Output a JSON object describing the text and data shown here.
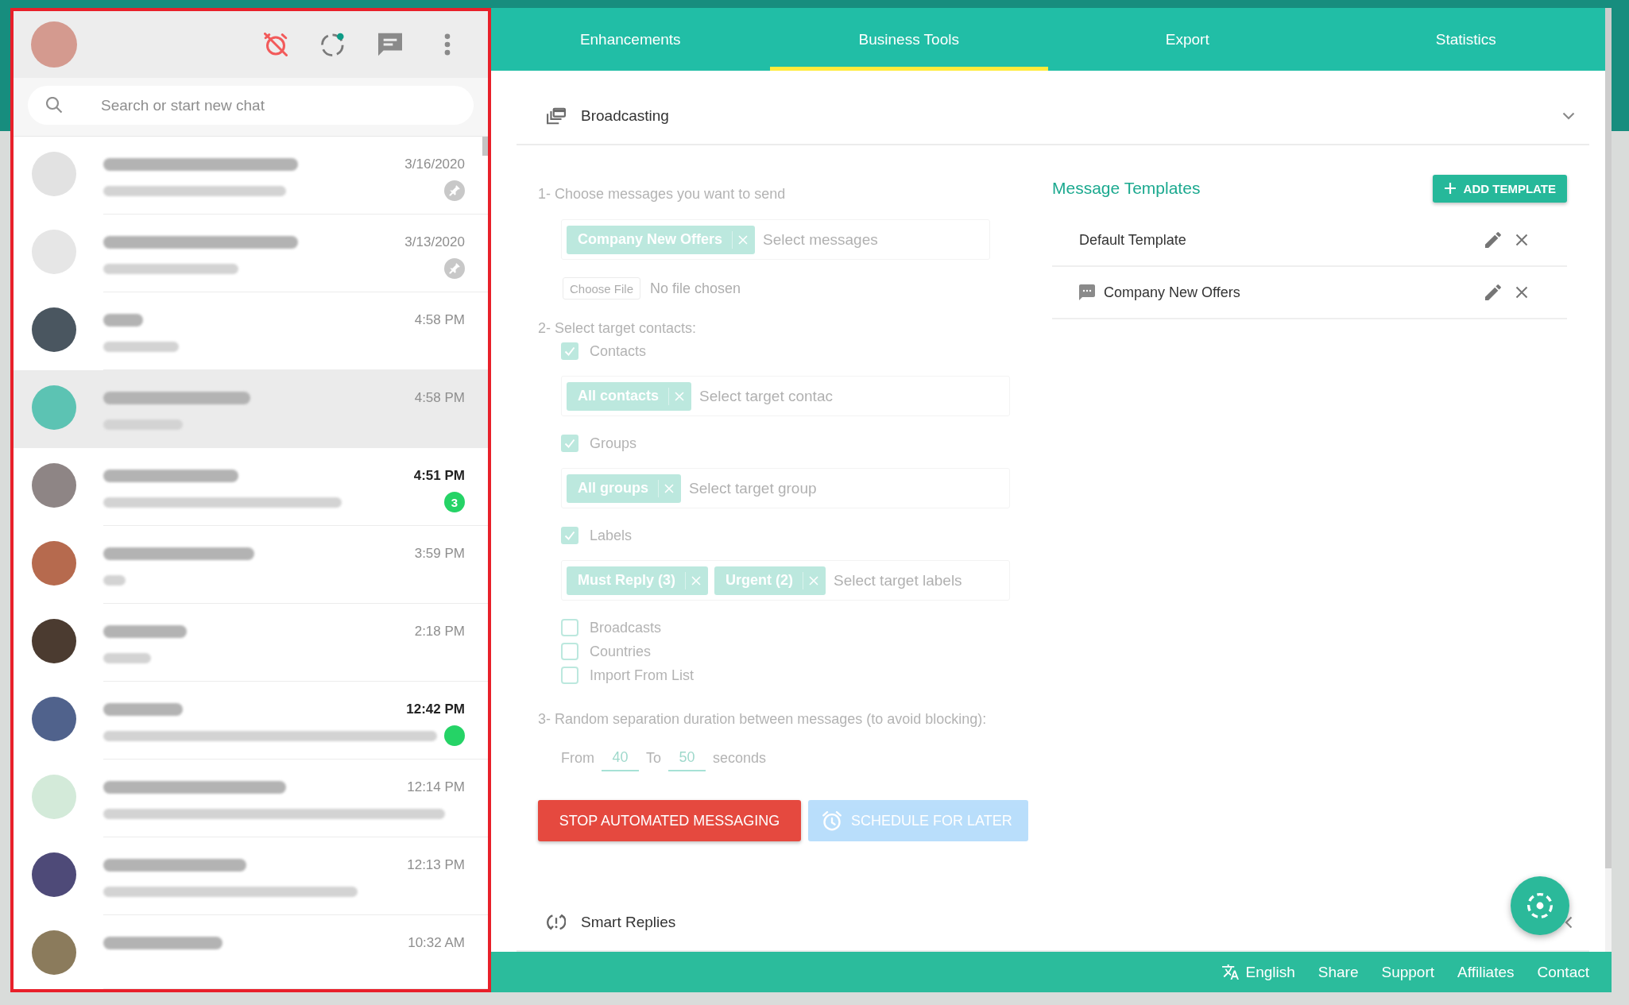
{
  "sidebar": {
    "search": {
      "placeholder": "Search or start new chat"
    },
    "chats": [
      {
        "time": "3/16/2020",
        "selected": false,
        "pinned": true,
        "unread": false
      },
      {
        "time": "3/13/2020",
        "selected": false,
        "pinned": true,
        "unread": false
      },
      {
        "time": "4:58 PM",
        "selected": false,
        "pinned": false,
        "unread": false
      },
      {
        "time": "4:58 PM",
        "selected": true,
        "pinned": false,
        "unread": false
      },
      {
        "time": "4:51 PM",
        "selected": false,
        "pinned": false,
        "unread": true,
        "badge": "3"
      },
      {
        "time": "3:59 PM",
        "selected": false,
        "pinned": false,
        "unread": false
      },
      {
        "time": "2:18 PM",
        "selected": false,
        "pinned": false,
        "unread": false
      },
      {
        "time": "12:42 PM",
        "selected": false,
        "pinned": false,
        "unread": true
      },
      {
        "time": "12:14 PM",
        "selected": false,
        "pinned": false,
        "unread": false
      },
      {
        "time": "12:13 PM",
        "selected": false,
        "pinned": false,
        "unread": false
      },
      {
        "time": "10:32 AM",
        "selected": false,
        "pinned": false,
        "unread": false
      }
    ]
  },
  "tabs": [
    {
      "label": "Enhancements",
      "selected": false
    },
    {
      "label": "Business Tools",
      "selected": true
    },
    {
      "label": "Export",
      "selected": false
    },
    {
      "label": "Statistics",
      "selected": false
    }
  ],
  "sections": [
    {
      "kind": "broadcasting",
      "title": "Broadcasting",
      "expanded": true,
      "broadcast": {
        "disabled": true,
        "step1": {
          "label": "1- Choose messages you want to send",
          "field": {
            "tags": [
              "Company New Offers"
            ],
            "placeholder": "Select messages"
          },
          "file_button": "Choose File",
          "file_status": "No file chosen"
        },
        "step2": {
          "label": "2- Select target contacts:",
          "targets": [
            {
              "label": "Contacts",
              "checked": true,
              "field": {
                "tags": [
                  "All contacts"
                ],
                "placeholder": "Select target contac"
              }
            },
            {
              "label": "Groups",
              "checked": true,
              "field": {
                "tags": [
                  "All groups"
                ],
                "placeholder": "Select target group"
              }
            },
            {
              "label": "Labels",
              "checked": true,
              "field": {
                "tags": [
                  "Must Reply (3)",
                  "Urgent (2)"
                ],
                "placeholder": "Select target labels"
              }
            },
            {
              "label": "Broadcasts",
              "checked": false
            },
            {
              "label": "Countries",
              "checked": false
            },
            {
              "label": "Import From List",
              "checked": false
            }
          ]
        },
        "step3": {
          "label": "3- Random separation duration between messages (to avoid blocking):",
          "from_label": "From",
          "from_value": "40",
          "to_label": "To",
          "to_value": "50",
          "unit": "seconds"
        },
        "buttons": [
          {
            "kind": "stop",
            "label": "STOP AUTOMATED MESSAGING",
            "disabled": false
          },
          {
            "kind": "schedule",
            "label": "SCHEDULE FOR LATER",
            "disabled": true
          }
        ]
      },
      "templates": {
        "title": "Message Templates",
        "add_button": "ADD TEMPLATE",
        "items": [
          {
            "kind": "plain",
            "name": "Default Template"
          },
          {
            "kind": "message",
            "name": "Company New Offers"
          }
        ]
      }
    },
    {
      "kind": "smart_replies",
      "title": "Smart Replies",
      "expanded": false
    }
  ],
  "footer": {
    "language": "English",
    "links": [
      "Share",
      "Support",
      "Affiliates",
      "Contact"
    ]
  }
}
